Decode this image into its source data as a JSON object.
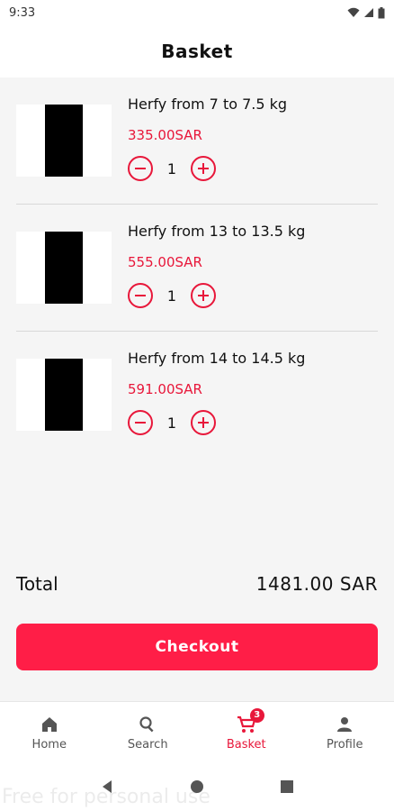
{
  "status_bar": {
    "time": "9:33"
  },
  "header": {
    "title": "Basket"
  },
  "items": [
    {
      "name": "Herfy from 7 to 7.5 kg",
      "price": "335.00SAR",
      "quantity": "1"
    },
    {
      "name": "Herfy from 13 to 13.5 kg",
      "price": "555.00SAR",
      "quantity": "1"
    },
    {
      "name": "Herfy from 14 to 14.5 kg",
      "price": "591.00SAR",
      "quantity": "1"
    }
  ],
  "total": {
    "label": "Total",
    "value": "1481.00 SAR"
  },
  "checkout": {
    "label": "Checkout"
  },
  "nav": {
    "home": "Home",
    "search": "Search",
    "basket": "Basket",
    "basket_badge": "3",
    "profile": "Profile"
  },
  "watermark": "Free for personal use",
  "colors": {
    "accent": "#e8173a",
    "button": "#ff1e47"
  }
}
